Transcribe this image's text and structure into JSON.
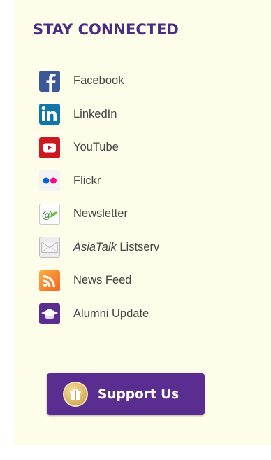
{
  "section": {
    "heading": "STAY CONNECTED"
  },
  "links": [
    {
      "label": "Facebook",
      "icon": "facebook-icon",
      "color": "#3b5998"
    },
    {
      "label": "LinkedIn",
      "icon": "linkedin-icon",
      "color": "#0e76a8"
    },
    {
      "label": "YouTube",
      "icon": "youtube-icon",
      "color": "#cc181e"
    },
    {
      "label": "Flickr",
      "icon": "flickr-icon",
      "color": "#0063dc"
    },
    {
      "label": "Newsletter",
      "icon": "newsletter-icon",
      "color": "#3e9a35"
    },
    {
      "label_italic": "AsiaTalk",
      "label_rest": " Listserv",
      "icon": "envelope-icon",
      "color": "#d9d9d9"
    },
    {
      "label": "News Feed",
      "icon": "rss-icon",
      "color": "#f58220"
    },
    {
      "label": "Alumni Update",
      "icon": "graduation-cap-icon",
      "color": "#5a2d91"
    }
  ],
  "support": {
    "label": "Support Us",
    "icon": "gift-icon",
    "color": "#5a2d91"
  }
}
